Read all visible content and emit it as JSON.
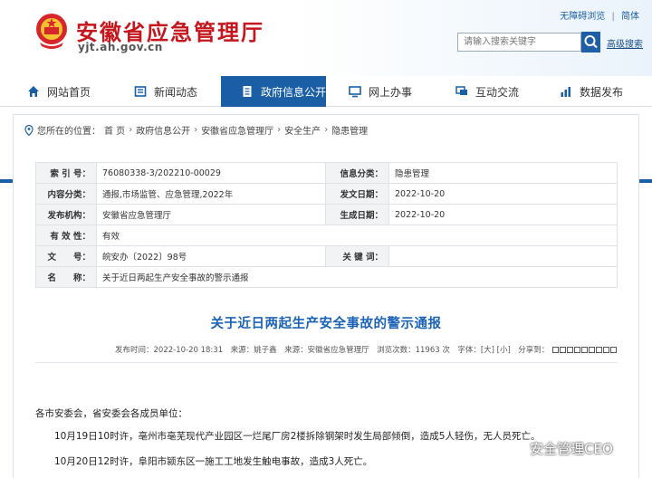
{
  "header": {
    "site_title": "安徽省应急管理厅",
    "site_url": "yjt.ah.gov.cn",
    "top_links": [
      "无障碍浏览",
      "|",
      "简体"
    ],
    "search_placeholder": "请输入搜索关键字",
    "advanced_search": "高级搜索",
    "colors": {
      "brand_red": "#c4161c",
      "nav_blue": "#1a5ea6"
    }
  },
  "nav": {
    "items": [
      {
        "label": "网站首页",
        "icon": "home-icon"
      },
      {
        "label": "新闻动态",
        "icon": "news-icon"
      },
      {
        "label": "政府信息公开",
        "icon": "document-icon",
        "active": true
      },
      {
        "label": "网上办事",
        "icon": "monitor-icon"
      },
      {
        "label": "互动交流",
        "icon": "chat-icon"
      },
      {
        "label": "数据发布",
        "icon": "chart-icon"
      }
    ]
  },
  "breadcrumb": {
    "prefix": "您所在的位置：",
    "items": [
      "首 页",
      "政府信息公开",
      "安徽省应急管理厅",
      "安全生产",
      "隐患管理"
    ],
    "separator": "›"
  },
  "info": {
    "index_no_label": "索 引 号：",
    "index_no": "76080338-3/202210-00029",
    "info_class_label": "信息分类：",
    "info_class": "隐患管理",
    "content_class_label": "内容分类：",
    "content_class": "通报,市场监管、应急管理,2022年",
    "publish_date_label": "发文日期：",
    "publish_date": "2022-10-20",
    "org_label": "发布机构：",
    "org": "安徽省应急管理厅",
    "created_date_label": "生成日期：",
    "created_date": "2022-10-20",
    "validity_label": "有 效 性：",
    "validity": "有效",
    "doc_no_label": "文　　号：",
    "doc_no": "皖安办〔2022〕98号",
    "keywords_label": "关 键 词：",
    "keywords": "",
    "name_label": "名　　称：",
    "name": "关于近日两起生产安全事故的警示通报"
  },
  "article": {
    "title": "关于近日两起生产安全事故的警示通报",
    "meta": "发布时间：2022-10-20 18:31　来源：姚子鑫　来源：安徽省应急管理厅　浏览次数：11963 次　字体：[大] [小]　分享到：",
    "paragraphs": [
      "各市安委会，省安委会各成员单位：",
      "10月19日10时许，亳州市亳芜现代产业园区一烂尾厂房2楼拆除钢架时发生局部倾倒，造成5人轻伤，无人员死亡。",
      "10月20日12时许，阜阳市颍东区一施工工地发生触电事故，造成3人死亡。"
    ]
  },
  "watermark": {
    "text": "安全管理CEO"
  }
}
